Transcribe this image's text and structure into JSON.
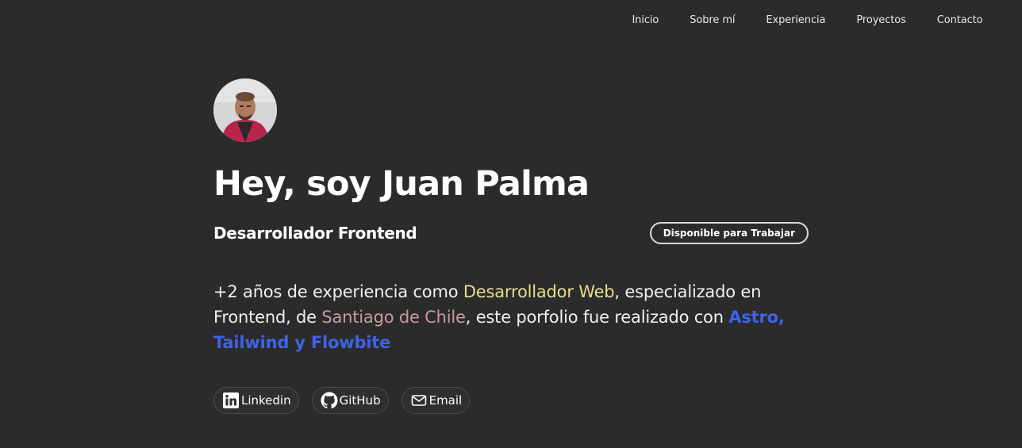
{
  "nav": {
    "items": [
      "Inicio",
      "Sobre mí",
      "Experiencia",
      "Proyectos",
      "Contacto"
    ]
  },
  "hero": {
    "title": "Hey, soy Juan Palma",
    "subtitle": "Desarrollador Frontend",
    "badge": "Disponible para Trabajar",
    "desc": {
      "part1": "+2 años de experiencia como ",
      "highlight1": "Desarrollador Web",
      "part2": ", especializado en Frontend, de ",
      "highlight2": "Santiago de Chile",
      "part3": ", este porfolio fue realizado con ",
      "highlight3": "Astro, Tailwind y Flowbite"
    }
  },
  "socials": {
    "linkedin": "Linkedin",
    "github": "GitHub",
    "email": "Email"
  },
  "colors": {
    "background": "#2b2b2b",
    "highlight_yellow": "#e8dc8c",
    "highlight_rose": "#c79aa0",
    "highlight_blue": "#3f63e6"
  }
}
